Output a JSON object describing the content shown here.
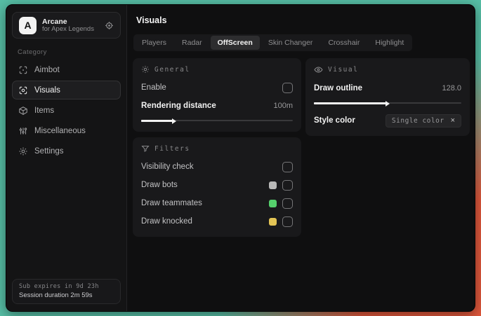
{
  "app": {
    "logo_letter": "A",
    "name": "Arcane",
    "subtitle": "for Apex Legends"
  },
  "sidebar": {
    "category_label": "Category",
    "items": [
      {
        "label": "Aimbot"
      },
      {
        "label": "Visuals"
      },
      {
        "label": "Items"
      },
      {
        "label": "Miscellaneous"
      },
      {
        "label": "Settings"
      }
    ],
    "footer": {
      "line1": "Sub expires in 9d 23h",
      "line2": "Session duration 2m 59s"
    }
  },
  "header": {
    "title": "Visuals"
  },
  "tabs": [
    {
      "label": "Players"
    },
    {
      "label": "Radar"
    },
    {
      "label": "OffScreen"
    },
    {
      "label": "Skin Changer"
    },
    {
      "label": "Crosshair"
    },
    {
      "label": "Highlight"
    }
  ],
  "panels": {
    "general": {
      "title": "General",
      "enable_label": "Enable",
      "distance_label": "Rendering distance",
      "distance_value": "100m",
      "distance_fill_percent": 21
    },
    "visual": {
      "title": "Visual",
      "outline_label": "Draw outline",
      "outline_value": "128.0",
      "outline_fill_percent": 49,
      "style_label": "Style color",
      "style_chip_value": "Single color",
      "chip_close": "×"
    },
    "filters": {
      "title": "Filters",
      "rows": [
        {
          "label": "Visibility check"
        },
        {
          "label": "Draw bots",
          "swatch": "#b8b8b8"
        },
        {
          "label": "Draw teammates",
          "swatch": "#55d06c"
        },
        {
          "label": "Draw knocked",
          "swatch": "#e3c455"
        }
      ]
    }
  },
  "colors": {
    "backdrop_teal": "#57bfa6",
    "backdrop_orange": "#e0583c"
  }
}
